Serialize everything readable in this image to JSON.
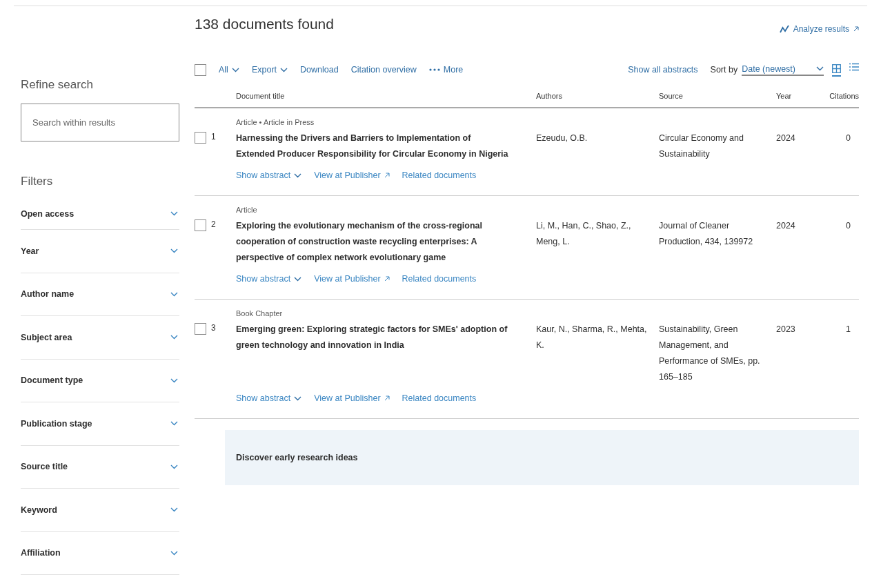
{
  "header": {
    "title": "138 documents found",
    "analyze_link": "Analyze results"
  },
  "sidebar": {
    "refine_title": "Refine search",
    "search": {
      "placeholder": "Search within results"
    },
    "filters_title": "Filters",
    "filters": [
      {
        "label": "Open access",
        "expanded": false
      },
      {
        "label": "Year",
        "expanded": false
      },
      {
        "label": "Author name",
        "expanded": false
      },
      {
        "label": "Subject area",
        "expanded": false
      },
      {
        "label": "Document type",
        "expanded": false
      },
      {
        "label": "Publication stage",
        "expanded": false
      },
      {
        "label": "Source title",
        "expanded": false
      },
      {
        "label": "Keyword",
        "expanded": false
      },
      {
        "label": "Affiliation",
        "expanded": false
      }
    ]
  },
  "toolbar": {
    "select_all": {
      "checked": false,
      "label": "All"
    },
    "actions": [
      {
        "label": "Export",
        "kind": "menu"
      },
      {
        "label": "Download",
        "kind": "link"
      },
      {
        "label": "Citation overview",
        "kind": "link"
      },
      {
        "label": "More",
        "kind": "more"
      }
    ],
    "show_all_abstracts": "Show all abstracts",
    "sort": {
      "label": "Sort by",
      "value": "Date (newest)"
    },
    "views": [
      {
        "kind": "grid",
        "selected": true
      },
      {
        "kind": "list",
        "selected": false
      }
    ]
  },
  "table": {
    "columns": [
      "Document title",
      "Authors",
      "Source",
      "Year",
      "Citations"
    ],
    "rows": [
      {
        "type": "Article • Article in Press",
        "checked": false,
        "number": "1",
        "title": "Harnessing the Drivers and Barriers to Implementation of Extended Producer Responsibility for Circular Economy in Nigeria",
        "authors": "Ezeudu, O.B.",
        "source": "Circular Economy and Sustainability",
        "year": "2024",
        "citations": "0",
        "links": [
          {
            "label": "Show abstract",
            "kind": "expand"
          },
          {
            "label": "View at Publisher",
            "kind": "external"
          },
          {
            "label": "Related documents",
            "kind": "plain"
          }
        ]
      },
      {
        "type": "Article",
        "checked": false,
        "number": "2",
        "title": "Exploring the evolutionary mechanism of the cross-regional cooperation of construction waste recycling enterprises: A perspective of complex network evolutionary game",
        "authors": "Li, M., Han, C., Shao, Z., Meng, L.",
        "source": "Journal of Cleaner Production, 434, 139972",
        "year": "2024",
        "citations": "0",
        "links": [
          {
            "label": "Show abstract",
            "kind": "expand"
          },
          {
            "label": "View at Publisher",
            "kind": "external"
          },
          {
            "label": "Related documents",
            "kind": "plain"
          }
        ]
      },
      {
        "type": "Book Chapter",
        "checked": false,
        "number": "3",
        "title": "Emerging green: Exploring strategic factors for SMEs' adoption of green technology and innovation in India",
        "authors": "Kaur, N., Sharma, R., Mehta, K.",
        "source": "Sustainability, Green Management, and Performance of SMEs, pp. 165–185",
        "year": "2023",
        "citations": "1",
        "links": [
          {
            "label": "Show abstract",
            "kind": "expand"
          },
          {
            "label": "View at Publisher",
            "kind": "external"
          },
          {
            "label": "Related documents",
            "kind": "plain"
          }
        ]
      }
    ]
  },
  "discover": {
    "title": "Discover early research ideas"
  }
}
